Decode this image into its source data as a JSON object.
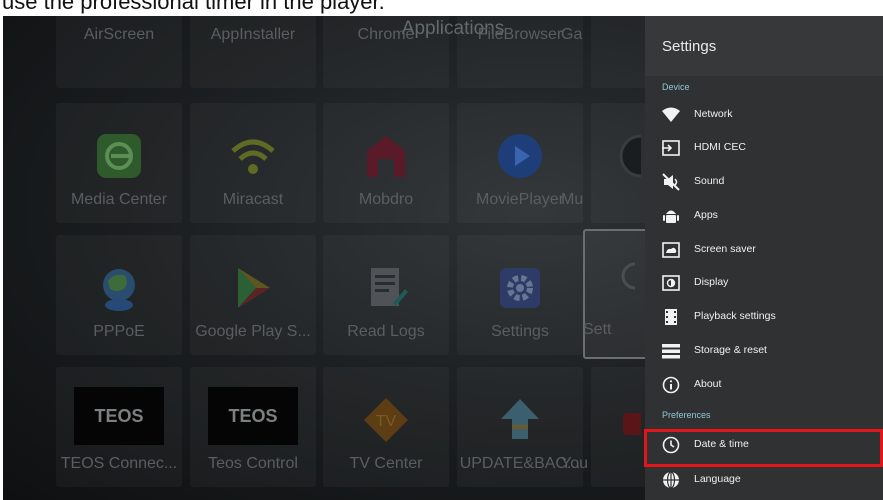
{
  "caption": "use the professional timer in the player.",
  "launcher": {
    "title": "Applications",
    "rows": [
      [
        "AirScreen",
        "AppInstaller",
        "Chrome",
        "FileBrowser",
        "Ga"
      ],
      [
        "Media Center",
        "Miracast",
        "Mobdro",
        "MoviePlayer",
        "Mu"
      ],
      [
        "PPPoE",
        "Google Play S...",
        "Read Logs",
        "Settings",
        "Sett"
      ],
      [
        "TEOS Connec...",
        "Teos Control",
        "TV Center",
        "UPDATE&BAC...",
        "You"
      ]
    ],
    "teos_logo": "TEOS",
    "tv_logo": "TV"
  },
  "settings": {
    "title": "Settings",
    "section_device": "Device",
    "section_preferences": "Preferences",
    "items": [
      {
        "label": "Network",
        "icon": "wifi-icon"
      },
      {
        "label": "HDMI CEC",
        "icon": "hdmi-input-icon"
      },
      {
        "label": "Sound",
        "icon": "sound-muted-icon"
      },
      {
        "label": "Apps",
        "icon": "android-icon"
      },
      {
        "label": "Screen saver",
        "icon": "screen-saver-icon"
      },
      {
        "label": "Display",
        "icon": "display-icon"
      },
      {
        "label": "Playback settings",
        "icon": "film-icon"
      },
      {
        "label": "Storage & reset",
        "icon": "storage-icon"
      },
      {
        "label": "About",
        "icon": "info-icon"
      },
      {
        "label": "Date & time",
        "icon": "clock-icon"
      },
      {
        "label": "Language",
        "icon": "globe-icon"
      }
    ]
  },
  "colors": {
    "panel_bg": "#2f3133",
    "section_accent": "#8ec9d4",
    "highlight": "#e4141b"
  }
}
